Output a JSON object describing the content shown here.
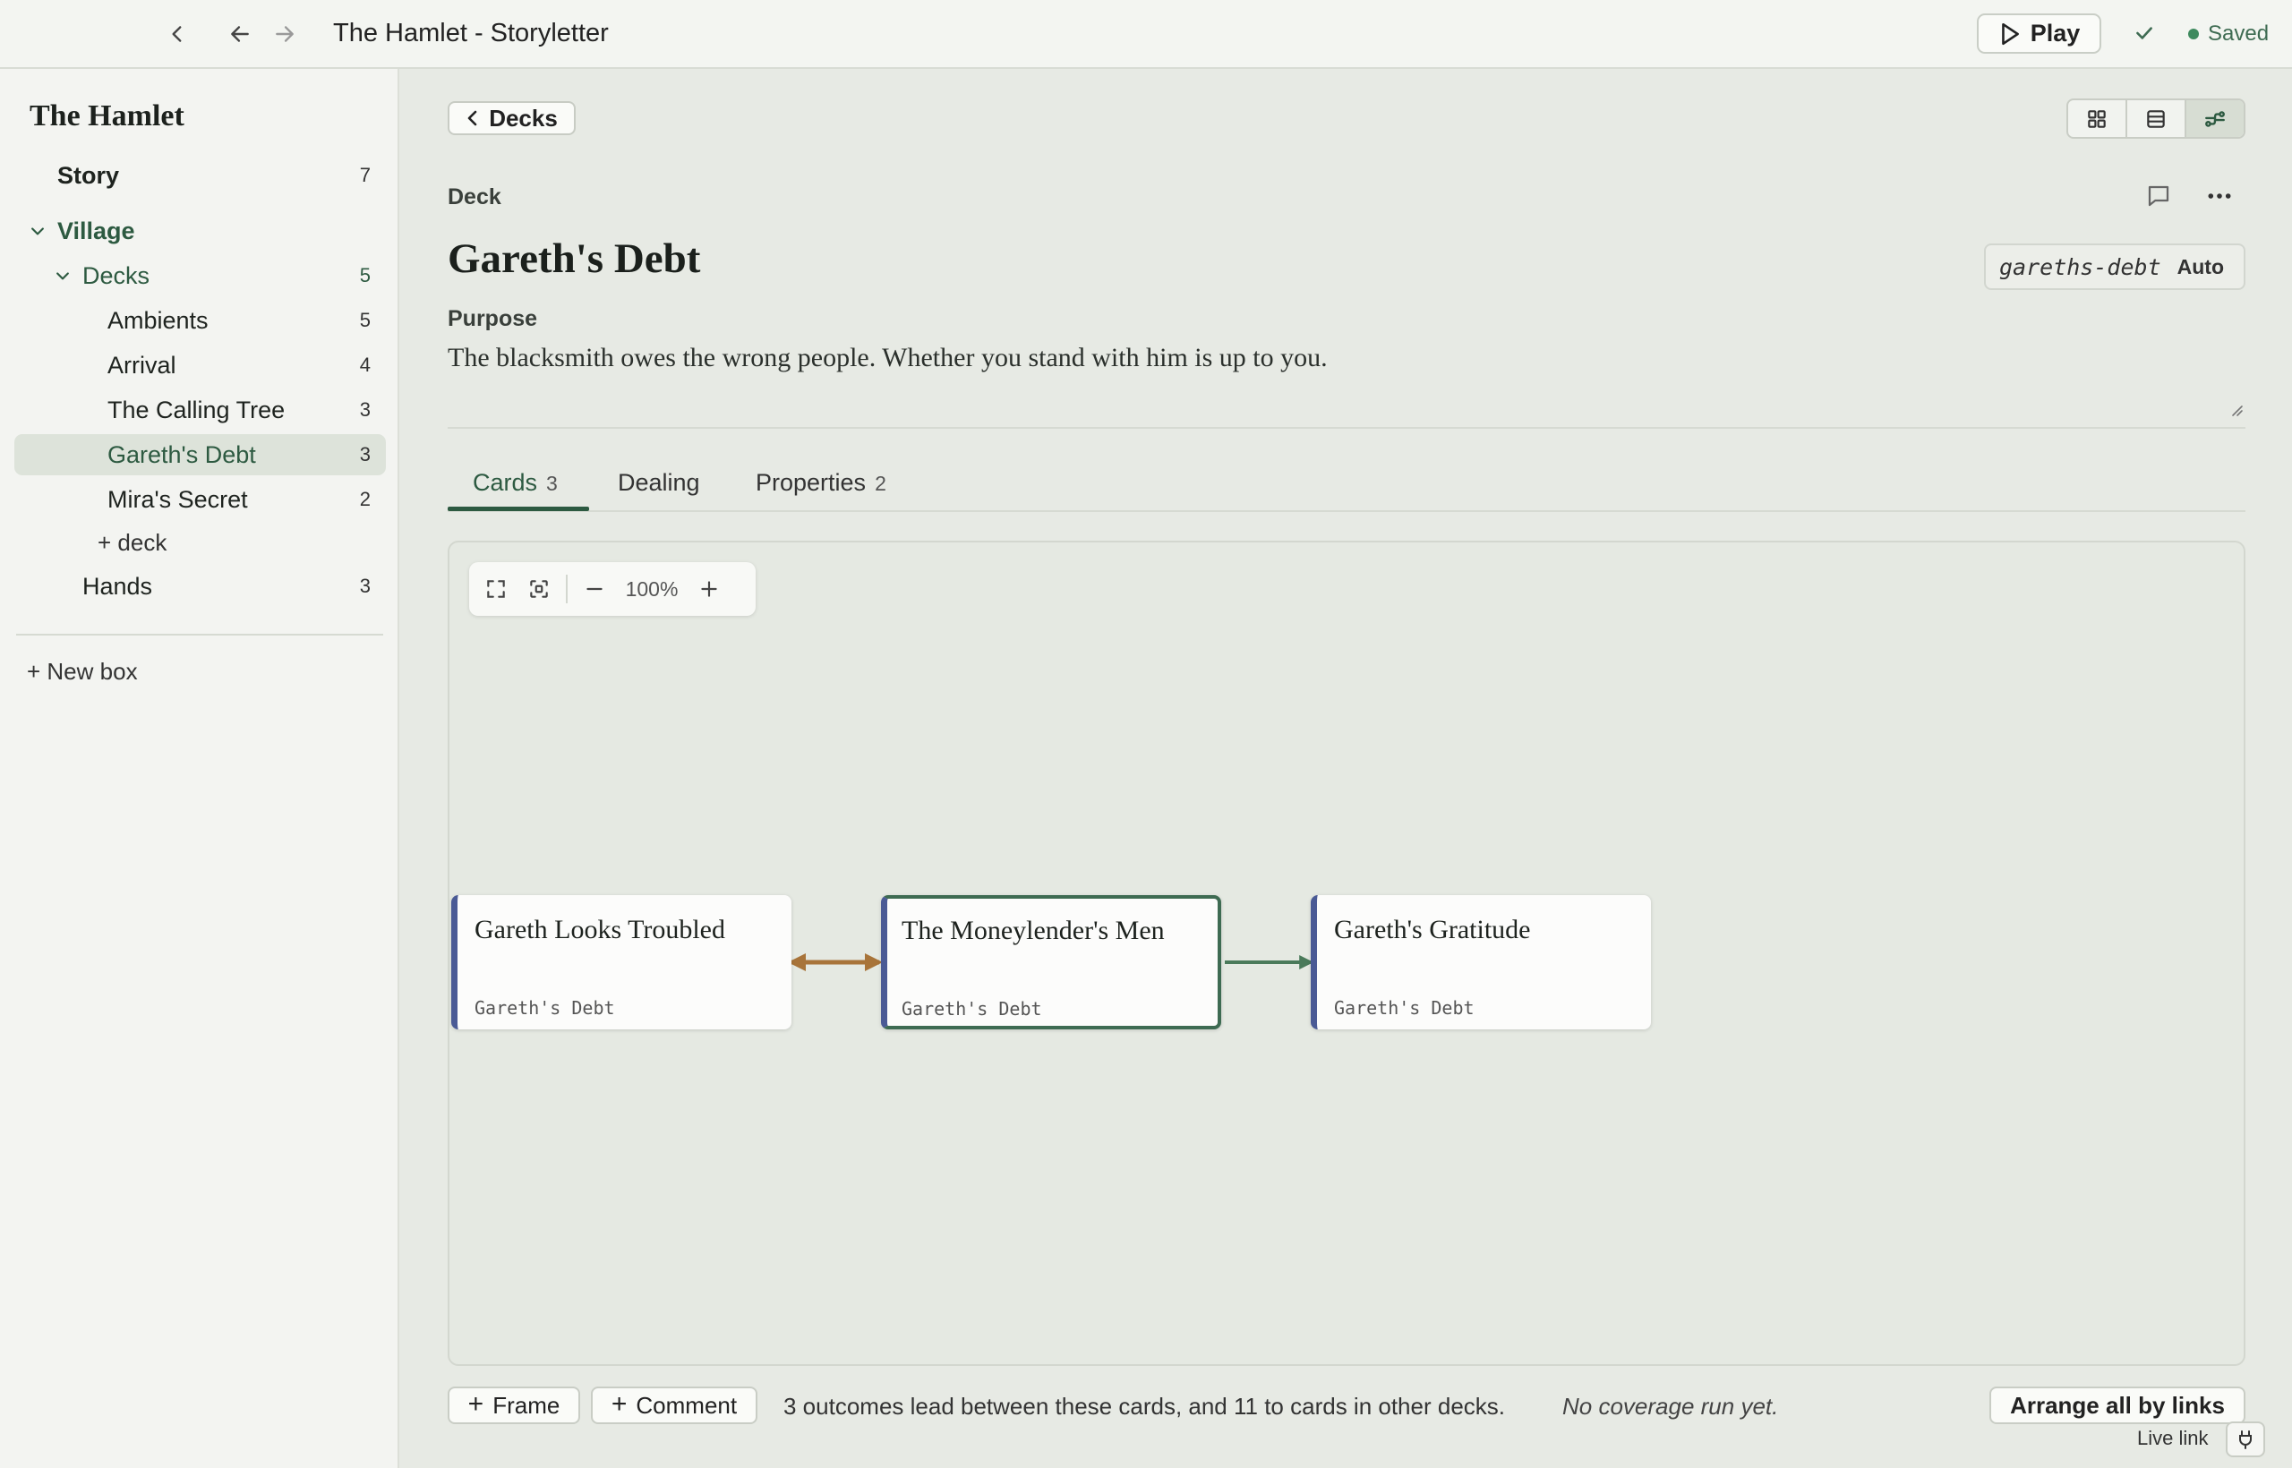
{
  "window": {
    "title": "The Hamlet - Storyletter",
    "play_label": "Play",
    "status_label": "Saved"
  },
  "sidebar": {
    "project_title": "The Hamlet",
    "story": {
      "label": "Story",
      "count": "7"
    },
    "village": {
      "label": "Village"
    },
    "decks": {
      "label": "Decks",
      "count": "5"
    },
    "deck_items": [
      {
        "label": "Ambients",
        "count": "5"
      },
      {
        "label": "Arrival",
        "count": "4"
      },
      {
        "label": "The Calling Tree",
        "count": "3"
      },
      {
        "label": "Gareth's Debt",
        "count": "3"
      },
      {
        "label": "Mira's Secret",
        "count": "2"
      }
    ],
    "add_deck_label": "+ deck",
    "hands": {
      "label": "Hands",
      "count": "3"
    },
    "new_box_label": "+ New box"
  },
  "main": {
    "back_label": "Decks",
    "kicker": "Deck",
    "title": "Gareth's Debt",
    "slug": "gareths-debt",
    "slug_mode": "Auto",
    "purpose_label": "Purpose",
    "purpose_text": "The blacksmith owes the wrong people. Whether you stand with him is up to you.",
    "tabs": [
      {
        "label": "Cards",
        "count": "3"
      },
      {
        "label": "Dealing",
        "count": ""
      },
      {
        "label": "Properties",
        "count": "2"
      }
    ]
  },
  "canvas": {
    "zoom": "100%",
    "cards": [
      {
        "title": "Gareth Looks Troubled",
        "deck": "Gareth's Debt"
      },
      {
        "title": "The Moneylender's Men",
        "deck": "Gareth's Debt"
      },
      {
        "title": "Gareth's Gratitude",
        "deck": "Gareth's Debt"
      }
    ],
    "colors": {
      "card_accent": "#4a5a95",
      "link_bidirectional": "#a8743a",
      "link_forward": "#4a7a5a",
      "selected_border": "#3e6b52"
    }
  },
  "footer": {
    "frame_label": "Frame",
    "comment_label": "Comment",
    "info": "3 outcomes lead between these cards, and 11 to cards in other decks.",
    "coverage": "No coverage run yet.",
    "arrange_label": "Arrange all by links",
    "live_link_label": "Live link"
  }
}
